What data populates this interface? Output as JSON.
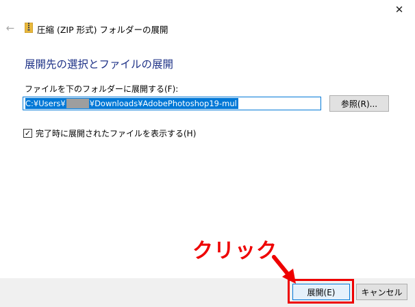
{
  "window": {
    "title": "圧縮 (ZIP 形式) フォルダーの展開",
    "close_glyph": "✕",
    "back_glyph": "←"
  },
  "heading": "展開先の選択とファイルの展開",
  "destination": {
    "label": "ファイルを下のフォルダーに展開する(F):",
    "value_prefix": "C:¥Users¥",
    "value_suffix": "¥Downloads¥AdobePhotoshop19-mul",
    "browse_label": "参照(R)..."
  },
  "options": {
    "show_files_label": "完了時に展開されたファイルを表示する(H)",
    "show_files_checked": true,
    "check_glyph": "✓"
  },
  "footer": {
    "extract_label": "展開(E)",
    "cancel_label": "キャンセル"
  },
  "annotation": {
    "text": "クリック",
    "color": "#ee0000"
  },
  "colors": {
    "accent": "#0078d7",
    "heading": "#1e3287",
    "zip_folder": "#e8b83c"
  },
  "icons": {
    "zip": "zip-folder-icon",
    "back": "back-arrow-icon",
    "close": "close-icon"
  }
}
